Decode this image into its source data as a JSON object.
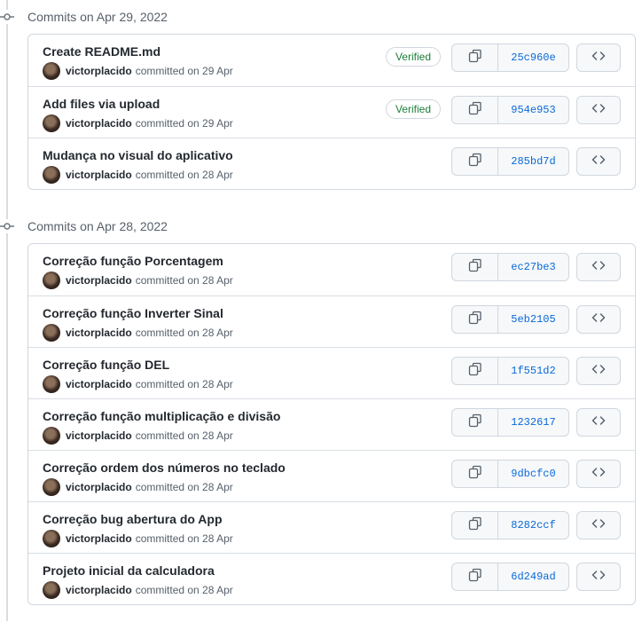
{
  "groups": [
    {
      "header": "Commits on Apr 29, 2022",
      "commits": [
        {
          "title": "Create README.md",
          "author": "victorplacido",
          "meta": "committed on 29 Apr",
          "verified": "Verified",
          "sha": "25c960e"
        },
        {
          "title": "Add files via upload",
          "author": "victorplacido",
          "meta": "committed on 29 Apr",
          "verified": "Verified",
          "sha": "954e953"
        },
        {
          "title": "Mudança no visual do aplicativo",
          "author": "victorplacido",
          "meta": "committed on 28 Apr",
          "sha": "285bd7d"
        }
      ]
    },
    {
      "header": "Commits on Apr 28, 2022",
      "commits": [
        {
          "title": "Correção função Porcentagem",
          "author": "victorplacido",
          "meta": "committed on 28 Apr",
          "sha": "ec27be3"
        },
        {
          "title": "Correção função Inverter Sinal",
          "author": "victorplacido",
          "meta": "committed on 28 Apr",
          "sha": "5eb2105"
        },
        {
          "title": "Correção função DEL",
          "author": "victorplacido",
          "meta": "committed on 28 Apr",
          "sha": "1f551d2"
        },
        {
          "title": "Correção função multiplicação e divisão",
          "author": "victorplacido",
          "meta": "committed on 28 Apr",
          "sha": "1232617"
        },
        {
          "title": "Correção ordem dos números no teclado",
          "author": "victorplacido",
          "meta": "committed on 28 Apr",
          "sha": "9dbcfc0"
        },
        {
          "title": "Correção bug abertura do App",
          "author": "victorplacido",
          "meta": "committed on 28 Apr",
          "sha": "8282ccf"
        },
        {
          "title": "Projeto inicial da calculadora",
          "author": "victorplacido",
          "meta": "committed on 28 Apr",
          "sha": "6d249ad"
        }
      ]
    }
  ],
  "icons": {
    "commit_node": "git-commit-icon",
    "copy": "copy-icon",
    "browse": "code-icon"
  },
  "colors": {
    "verified": "#1a7f37",
    "sha_link": "#0969da",
    "muted_text": "#57606a",
    "border": "#d0d7de"
  }
}
